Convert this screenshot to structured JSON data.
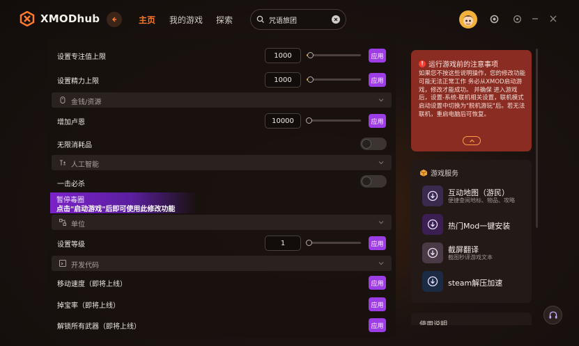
{
  "app": {
    "name": "XMODhub"
  },
  "nav": {
    "home": "主页",
    "my_games": "我的游戏",
    "explore": "探索"
  },
  "search": {
    "value": "咒语旅团"
  },
  "colors": {
    "accent": "#ff7a2a",
    "apply": "#9d3de6",
    "warning_bg": "#8a2c22"
  },
  "settings": {
    "focus_max": {
      "label": "设置专注值上限",
      "value": "1000",
      "apply": "应用",
      "level": 0.0
    },
    "energy_max": {
      "label": "设置精力上限",
      "value": "1000",
      "apply": "应用",
      "level": 0.0
    },
    "money_section": "金钱/资源",
    "add_lu_en": {
      "label": "增加卢恩",
      "value": "10000",
      "apply": "应用"
    },
    "infinite_consumables": {
      "label": "无限消耗品",
      "enabled": false
    },
    "ai_section": "人工智能",
    "one_hit_kill": {
      "label": "一击必杀",
      "enabled": false
    },
    "banner": {
      "title": "暂停毒圈",
      "subtitle": "点击\"启动游戏\"后即可使用此修改功能"
    },
    "unit_section": "单位",
    "set_level": {
      "label": "设置等级",
      "value": "1",
      "apply": "应用"
    },
    "dev_section": "开发代码",
    "move_speed": {
      "label": "移动速度（即将上线）",
      "apply": "应用"
    },
    "drop_rate": {
      "label": "掉宝率（即将上线）",
      "apply": "应用"
    },
    "unlock_weapons": {
      "label": "解锁所有武器（即将上线）",
      "apply": "应用"
    }
  },
  "warning": {
    "title": "运行游戏前的注意事项",
    "body": "如果您不按这些说明操作，您的修改功能可能无法正常工作 务必从XMOD启动游戏，修改才能成功。 并确保 进入游戏后，设置-系统-联机相关设置，联机模式启动设置中切换为\"脱机游玩\"后。若无法联机，重启电脑后可恢复。"
  },
  "services": {
    "title": "游戏服务",
    "items": [
      {
        "name": "互动地图（游民）",
        "desc": "便捷查阅地标、物品、攻略",
        "icon": "download-icon"
      },
      {
        "name": "热门Mod一键安装",
        "desc": "",
        "icon": "download-icon"
      },
      {
        "name": "截屏翻译",
        "desc": "截图秒译游戏文本",
        "icon": "download-icon"
      },
      {
        "name": "steam解压加速",
        "desc": "",
        "icon": "download-icon"
      }
    ]
  },
  "usage": {
    "title": "使用说明"
  }
}
